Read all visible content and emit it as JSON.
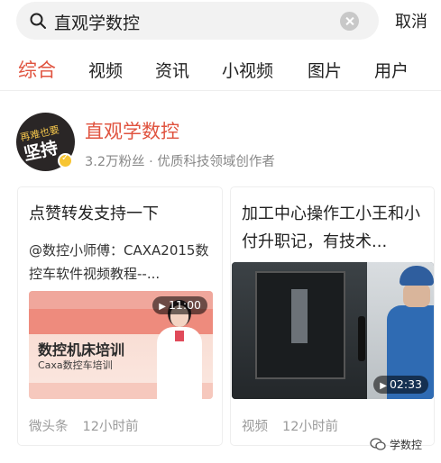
{
  "search": {
    "query": "直观学数控",
    "cancel_label": "取消"
  },
  "tabs": [
    {
      "label": "综合",
      "active": true
    },
    {
      "label": "视频",
      "active": false
    },
    {
      "label": "资讯",
      "active": false
    },
    {
      "label": "小视频",
      "active": false
    },
    {
      "label": "图片",
      "active": false
    },
    {
      "label": "用户",
      "active": false
    }
  ],
  "profile": {
    "name": "直观学数控",
    "meta": "3.2万粉丝 · 优质科技领域创作者",
    "avatar_text_top": "再难也要",
    "avatar_text_main": "坚持"
  },
  "cards": [
    {
      "title": "点赞转发支持一下",
      "description": "@数控小师傅：CAXA2015数控车软件视频教程--...",
      "duration": "11:00",
      "thumb_title": "数控机床培训",
      "thumb_subtitle": "Caxa数控车培训",
      "source": "微头条",
      "time": "12小时前"
    },
    {
      "title": "加工中心操作工小王和小付升职记，有技术...",
      "duration": "02:33",
      "source": "视频",
      "time": "12小时前"
    }
  ],
  "watermark": {
    "text": "学数控"
  },
  "colors": {
    "accent": "#e0533f",
    "verify_badge": "#f7c532"
  }
}
